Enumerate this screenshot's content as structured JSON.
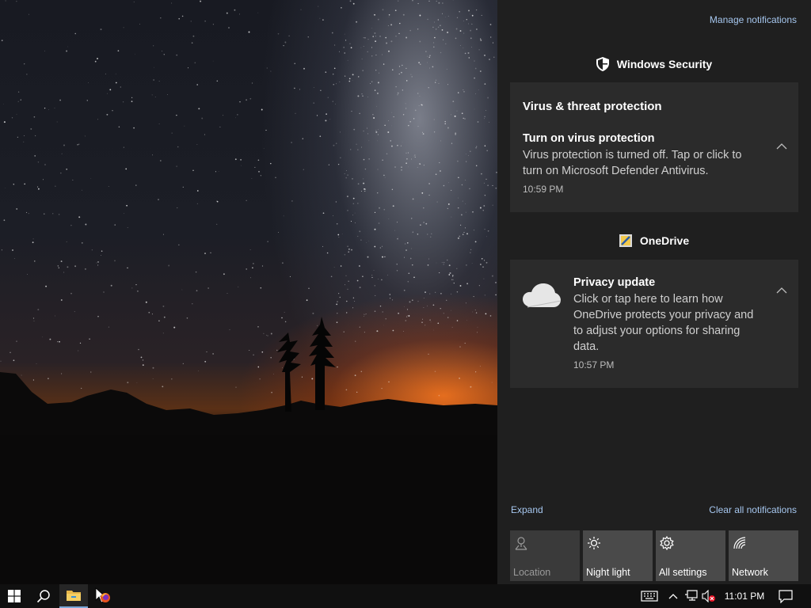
{
  "action_center": {
    "manage_notifications": "Manage notifications",
    "groups": [
      {
        "app_name": "Windows Security",
        "icon": "shield-icon",
        "notification": {
          "heading": "Virus & threat protection",
          "title": "Turn on virus protection",
          "body_lines": [
            "Virus protection is turned off. Tap or click to",
            "turn on Microsoft Defender Antivirus."
          ],
          "time": "10:59 PM"
        }
      },
      {
        "app_name": "OneDrive",
        "icon": "onedrive-app-icon",
        "notification": {
          "title": "Privacy update",
          "body_lines": [
            "Click or tap here to learn how",
            "OneDrive protects your privacy and",
            "to adjust your options for sharing",
            "data."
          ],
          "time": "10:57 PM"
        }
      }
    ],
    "expand_label": "Expand",
    "clear_all_label": "Clear all notifications",
    "quick_actions": [
      {
        "label": "Location",
        "icon": "location-icon",
        "state": "disabled"
      },
      {
        "label": "Night light",
        "icon": "brightness-icon",
        "state": "available"
      },
      {
        "label": "All settings",
        "icon": "gear-icon",
        "state": "available"
      },
      {
        "label": "Network",
        "icon": "network-icon",
        "state": "available"
      }
    ]
  },
  "taskbar": {
    "start_icon": "windows-logo-icon",
    "search_icon": "search-icon",
    "apps": [
      {
        "name": "File Explorer",
        "icon": "file-explorer-icon",
        "active": true
      },
      {
        "name": "Firefox",
        "icon": "firefox-icon",
        "active": false
      }
    ],
    "tray_icons": [
      "keyboard-icon",
      "chevron-up-icon",
      "network-disconnected-icon",
      "volume-muted-icon"
    ],
    "clock": "11:01 PM",
    "action_center_icon": "action-center-icon"
  },
  "colors": {
    "panel_bg": "#1f1f1f",
    "card_bg": "#2b2b2b",
    "link": "#a6c7ef",
    "taskbar_bg": "#101010"
  }
}
